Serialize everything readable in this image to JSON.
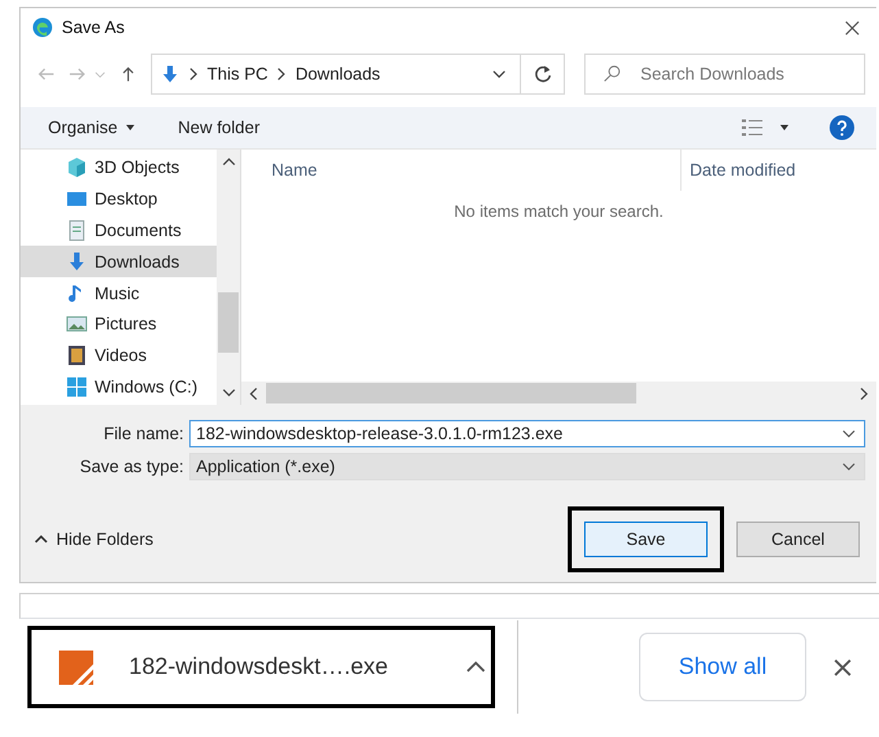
{
  "window": {
    "title": "Save As"
  },
  "address": {
    "crumbs": [
      "This PC",
      "Downloads"
    ]
  },
  "search": {
    "placeholder": "Search Downloads"
  },
  "toolbar": {
    "organise": "Organise",
    "new_folder": "New folder"
  },
  "sidebar": {
    "items": [
      {
        "label": "3D Objects",
        "kind": "cube",
        "selected": false
      },
      {
        "label": "Desktop",
        "kind": "desktop",
        "selected": false
      },
      {
        "label": "Documents",
        "kind": "document",
        "selected": false
      },
      {
        "label": "Downloads",
        "kind": "download",
        "selected": true
      },
      {
        "label": "Music",
        "kind": "music",
        "selected": false
      },
      {
        "label": "Pictures",
        "kind": "picture",
        "selected": false
      },
      {
        "label": "Videos",
        "kind": "video",
        "selected": false
      },
      {
        "label": "Windows (C:)",
        "kind": "drive",
        "selected": false
      }
    ]
  },
  "file_list": {
    "columns": [
      "Name",
      "Date modified"
    ],
    "empty_message": "No items match your search."
  },
  "form": {
    "file_name": {
      "label": "File name:",
      "value": "182-windowsdesktop-release-3.0.1.0-rm123.exe"
    },
    "save_as_type": {
      "label": "Save as type:",
      "value": "Application (*.exe)"
    }
  },
  "hide_folders": "Hide Folders",
  "buttons": [
    {
      "label": "Save",
      "default": true
    },
    {
      "label": "Cancel",
      "default": false
    }
  ],
  "download_bar": {
    "file": "182-windowsdeskt….exe",
    "show_all": "Show all"
  }
}
